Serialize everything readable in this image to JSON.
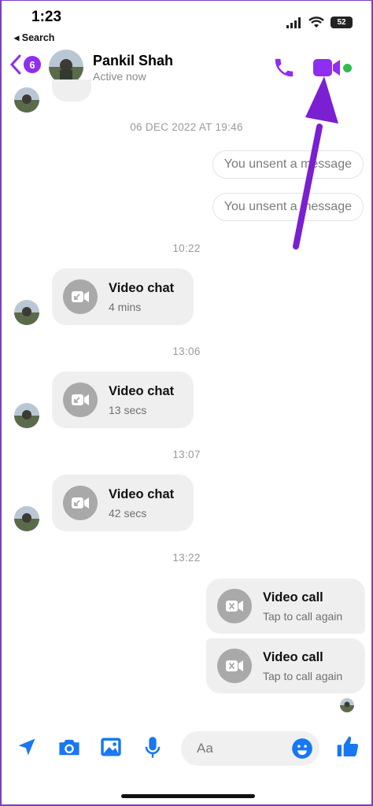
{
  "status_bar": {
    "time": "1:23",
    "back_label": "◂ Search",
    "battery": "52"
  },
  "header": {
    "unread_count": "6",
    "name": "Pankil Shah",
    "status": "Active now"
  },
  "messages": {
    "date_stamp": "06 DEC 2022 AT 19:46",
    "unsent_1": "You unsent a message",
    "unsent_2": "You unsent a message",
    "time_1": "10:22",
    "call_1": {
      "title": "Video chat",
      "sub": "4 mins"
    },
    "time_2": "13:06",
    "call_2": {
      "title": "Video chat",
      "sub": "13 secs"
    },
    "time_3": "13:07",
    "call_3": {
      "title": "Video chat",
      "sub": "42 secs"
    },
    "time_4": "13:22",
    "call_4": {
      "title": "Video call",
      "sub": "Tap to call again"
    },
    "call_5": {
      "title": "Video call",
      "sub": "Tap to call again"
    }
  },
  "composer": {
    "placeholder": "Aa"
  },
  "colors": {
    "accent": "#8f2ef0",
    "blue": "#1877f2",
    "online": "#2dbd4e",
    "arrow": "#7a1fd1"
  }
}
